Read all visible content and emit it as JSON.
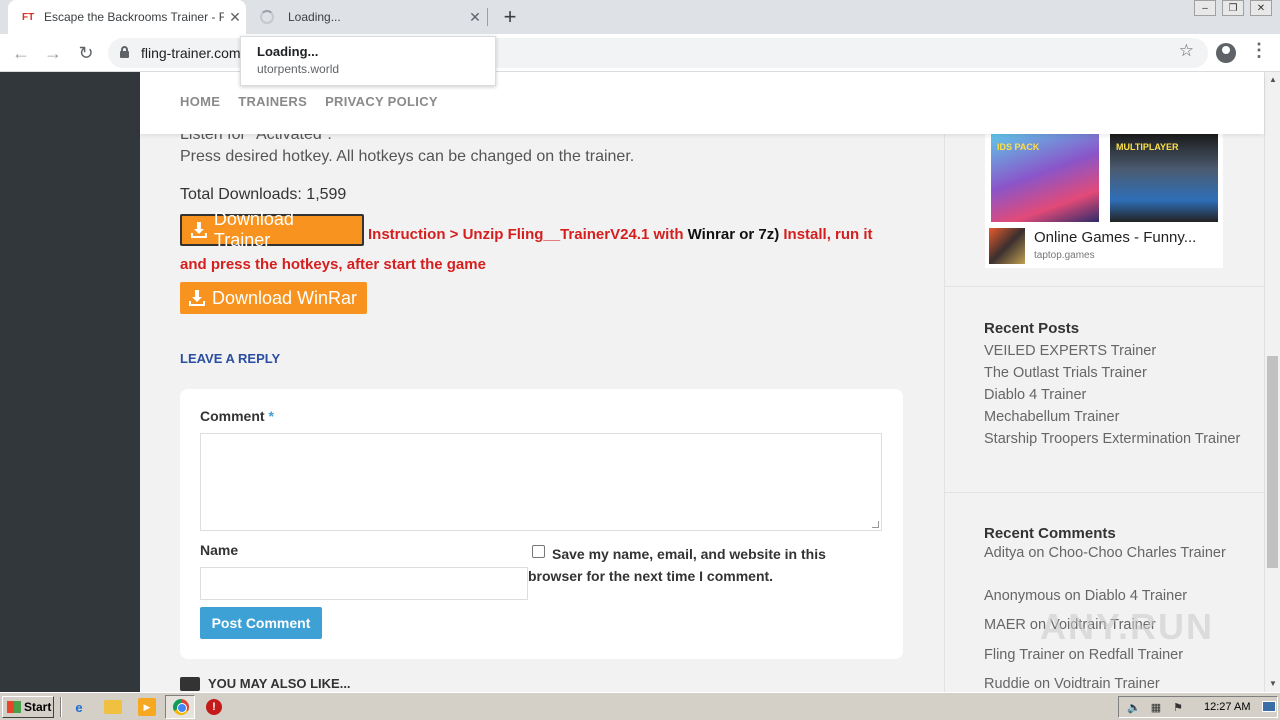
{
  "browser": {
    "tabs": [
      {
        "favicon": "FT",
        "title": "Escape the Backrooms Trainer - Fling",
        "close": "✕"
      },
      {
        "title": "Loading...",
        "close": "✕"
      }
    ],
    "new_tab": "+",
    "url": "fling-trainer.com",
    "tooltip": {
      "title": "Loading...",
      "url": "utorpents.world"
    }
  },
  "site": {
    "nav": [
      "HOME",
      "TRAINERS",
      "PRIVACY POLICY"
    ],
    "body_lines": [
      "Listen for \"Activated\".",
      "Press desired hotkey. All hotkeys can be changed on the trainer."
    ],
    "total_downloads": "Total Downloads: 1,599",
    "download_trainer": "Download Trainer",
    "instruction": {
      "part1": "Instruction > Unzip Fling__TrainerV24.1 with ",
      "part2": "Winrar or 7z)",
      "part3": " Install, run it and press the hotkeys, after start the game"
    },
    "download_winrar": "Download WinRar",
    "leave_reply": "LEAVE A REPLY",
    "comment_form": {
      "comment_label": "Comment",
      "required_mark": "*",
      "name_label": "Name",
      "save_text": "Save my name, email, and website in this browser for the next time I comment.",
      "post_button": "Post Comment"
    },
    "you_may_also_like": "YOU MAY ALSO LIKE..."
  },
  "sidebar": {
    "ad": {
      "badge_left": "IDS PACK",
      "badge_right": "MULTIPLAYER",
      "title": "Online Games - Funny...",
      "domain": "taptop.games"
    },
    "recent_posts_heading": "Recent Posts",
    "recent_posts": [
      "VEILED EXPERTS Trainer",
      "The Outlast Trials Trainer",
      "Diablo 4 Trainer",
      "Mechabellum Trainer",
      "Starship Troopers Extermination Trainer"
    ],
    "recent_comments_heading": "Recent Comments",
    "recent_comments": [
      "Aditya on Choo-Choo Charles Trainer",
      "Anonymous on Diablo 4 Trainer",
      "MAER on Voidtrain Trainer",
      "Fling Trainer on Redfall Trainer",
      "Ruddie on Voidtrain Trainer"
    ],
    "watermark": "ANY.RUN"
  },
  "taskbar": {
    "start": "Start",
    "clock": "12:27 AM"
  },
  "icons": [
    "back-arrow-icon",
    "forward-arrow-icon",
    "reload-icon",
    "lock-icon",
    "star-icon",
    "profile-icon",
    "menu-icon",
    "download-icon"
  ]
}
